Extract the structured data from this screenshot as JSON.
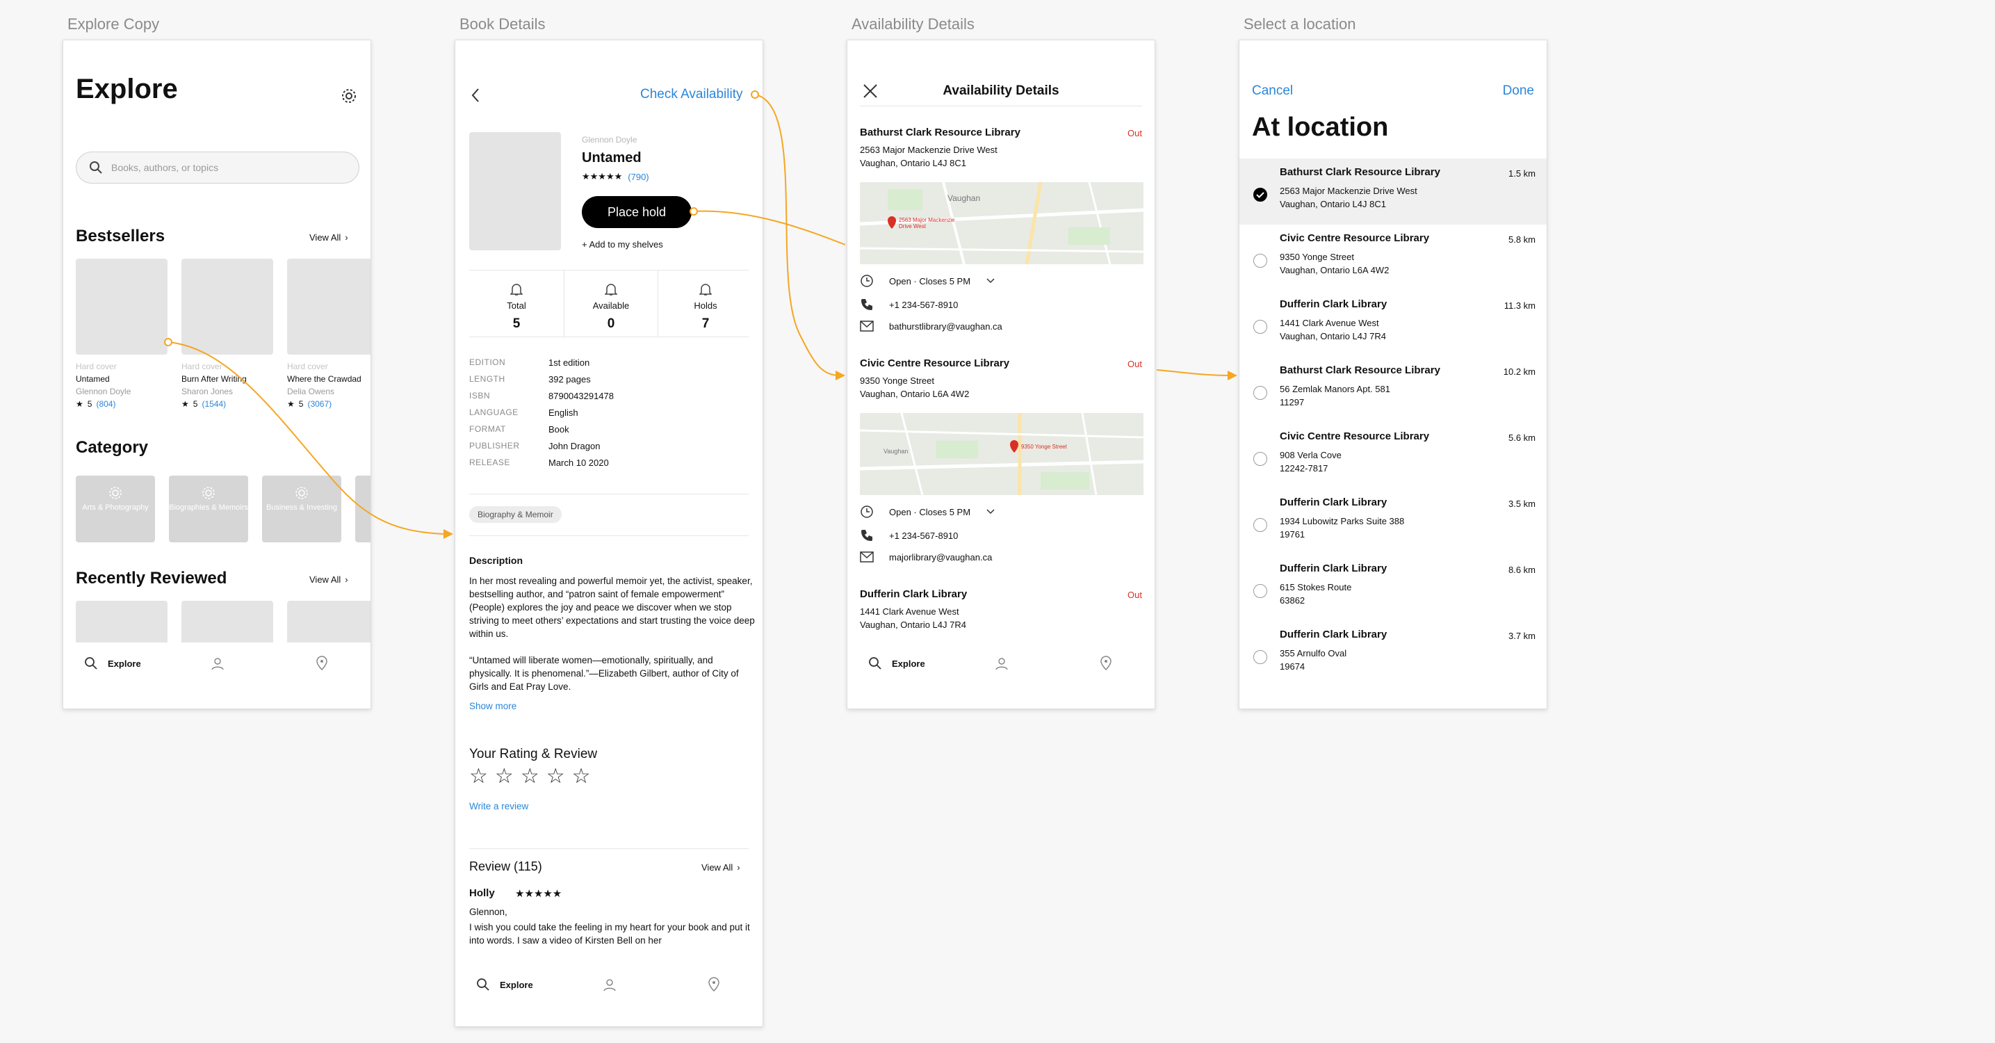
{
  "artboards": {
    "explore": "Explore Copy",
    "details": "Book Details",
    "availability": "Availability Details",
    "location": "Select a location"
  },
  "explore": {
    "title": "Explore",
    "search_placeholder": "Books, authors, or topics",
    "bestsellers": "Bestsellers",
    "view_all": "View All",
    "books": [
      {
        "format": "Hard cover",
        "title": "Untamed",
        "author": "Glennon Doyle",
        "rating": "5",
        "count": "(804)"
      },
      {
        "format": "Hard cover",
        "title": "Burn After Writing",
        "author": "Sharon Jones",
        "rating": "5",
        "count": "(1544)"
      },
      {
        "format": "Hard cover",
        "title": "Where the Crawdad",
        "author": "Delia Owens",
        "rating": "5",
        "count": "(3067)"
      }
    ],
    "category": "Category",
    "categories": [
      "Arts & Photography",
      "Biographies & Memoirs",
      "Business & Investing"
    ],
    "recently_reviewed": "Recently Reviewed",
    "view_all_2": "View All",
    "tab_explore": "Explore"
  },
  "details": {
    "check_availability": "Check Availability",
    "author": "Glennon Doyle",
    "title": "Untamed",
    "rating_count": "(790)",
    "place_hold": "Place hold",
    "add_shelves": "+ Add to my shelves",
    "stats": [
      {
        "label": "Total",
        "value": "5"
      },
      {
        "label": "Available",
        "value": "0"
      },
      {
        "label": "Holds",
        "value": "7"
      }
    ],
    "meta": [
      {
        "k": "EDITION",
        "v": "1st edition"
      },
      {
        "k": "LENGTH",
        "v": "392 pages"
      },
      {
        "k": "ISBN",
        "v": "8790043291478"
      },
      {
        "k": "LANGUAGE",
        "v": "English"
      },
      {
        "k": "FORMAT",
        "v": "Book"
      },
      {
        "k": "PUBLISHER",
        "v": "John Dragon"
      },
      {
        "k": "RELEASE",
        "v": "March 10 2020"
      }
    ],
    "tag": "Biography & Memoir",
    "description_heading": "Description",
    "description_1": "In her most revealing and powerful memoir yet, the activist, speaker, bestselling author, and “patron saint of female empowerment” (People) explores the joy and peace we discover when we stop striving to meet others’ expectations and start trusting the voice deep within us.",
    "description_2": "“Untamed will liberate women—emotionally, spiritually, and physically. It is phenomenal.”—Elizabeth Gilbert, author of City of Girls and Eat Pray Love.",
    "show_more": "Show more",
    "your_rating": "Your Rating & Review",
    "write_review": "Write a review",
    "review_heading": "Review (115)",
    "review_view_all": "View All",
    "reviewer": "Holly",
    "review_greeting": "Glennon,",
    "review_body": "I wish you could take the feeling in my heart for your book and put it into words. I saw a video of Kirsten Bell on her",
    "tab_explore": "Explore"
  },
  "availability": {
    "title": "Availability Details",
    "libraries": [
      {
        "name": "Bathurst Clark Resource Library",
        "status": "Out",
        "addr1": "2563 Major Mackenzie Drive West",
        "addr2": "Vaughan, Ontario L4J 8C1",
        "hours": "Open  ·  Closes 5 PM",
        "phone": "+1 234-567-8910",
        "email": "bathurstlibrary@vaughan.ca",
        "map_label": "2563 Major Mackenzie Drive West",
        "map_city": "Vaughan"
      },
      {
        "name": "Civic Centre Resource Library",
        "status": "Out",
        "addr1": "9350 Yonge Street",
        "addr2": "Vaughan, Ontario L6A 4W2",
        "hours": "Open  ·  Closes 5 PM",
        "phone": "+1 234-567-8910",
        "email": "majorlibrary@vaughan.ca",
        "map_label": "9350 Yonge Street",
        "map_city": "Vaughan"
      },
      {
        "name": "Dufferin Clark Library",
        "status": "Out",
        "addr1": "1441 Clark Avenue West",
        "addr2": "Vaughan, Ontario L4J 7R4"
      }
    ],
    "tab_explore": "Explore"
  },
  "location": {
    "cancel": "Cancel",
    "done": "Done",
    "title": "At location",
    "items": [
      {
        "name": "Bathurst Clark Resource Library",
        "addr1": "2563 Major Mackenzie Drive West",
        "addr2": "Vaughan, Ontario L4J 8C1",
        "km": "1.5 km",
        "selected": true
      },
      {
        "name": "Civic Centre Resource Library",
        "addr1": "9350 Yonge Street",
        "addr2": "Vaughan, Ontario L6A 4W2",
        "km": "5.8 km"
      },
      {
        "name": "Dufferin Clark Library",
        "addr1": "1441 Clark Avenue West",
        "addr2": "Vaughan, Ontario L4J 7R4",
        "km": "11.3 km"
      },
      {
        "name": "Bathurst Clark Resource Library",
        "addr1": "56 Zemlak Manors Apt. 581",
        "addr2": "11297",
        "km": "10.2 km"
      },
      {
        "name": "Civic Centre Resource Library",
        "addr1": "908 Verla Cove",
        "addr2": "12242-7817",
        "km": "5.6 km"
      },
      {
        "name": "Dufferin Clark Library",
        "addr1": "1934 Lubowitz Parks Suite 388",
        "addr2": "19761",
        "km": "3.5 km"
      },
      {
        "name": "Dufferin Clark Library",
        "addr1": "615 Stokes Route",
        "addr2": "63862",
        "km": "8.6 km"
      },
      {
        "name": "Dufferin Clark Library",
        "addr1": "355 Arnulfo Oval",
        "addr2": "19674",
        "km": "3.7 km"
      }
    ]
  },
  "colors": {
    "accent": "#2a86d9",
    "connector": "#f5a623",
    "out": "#d93025"
  }
}
